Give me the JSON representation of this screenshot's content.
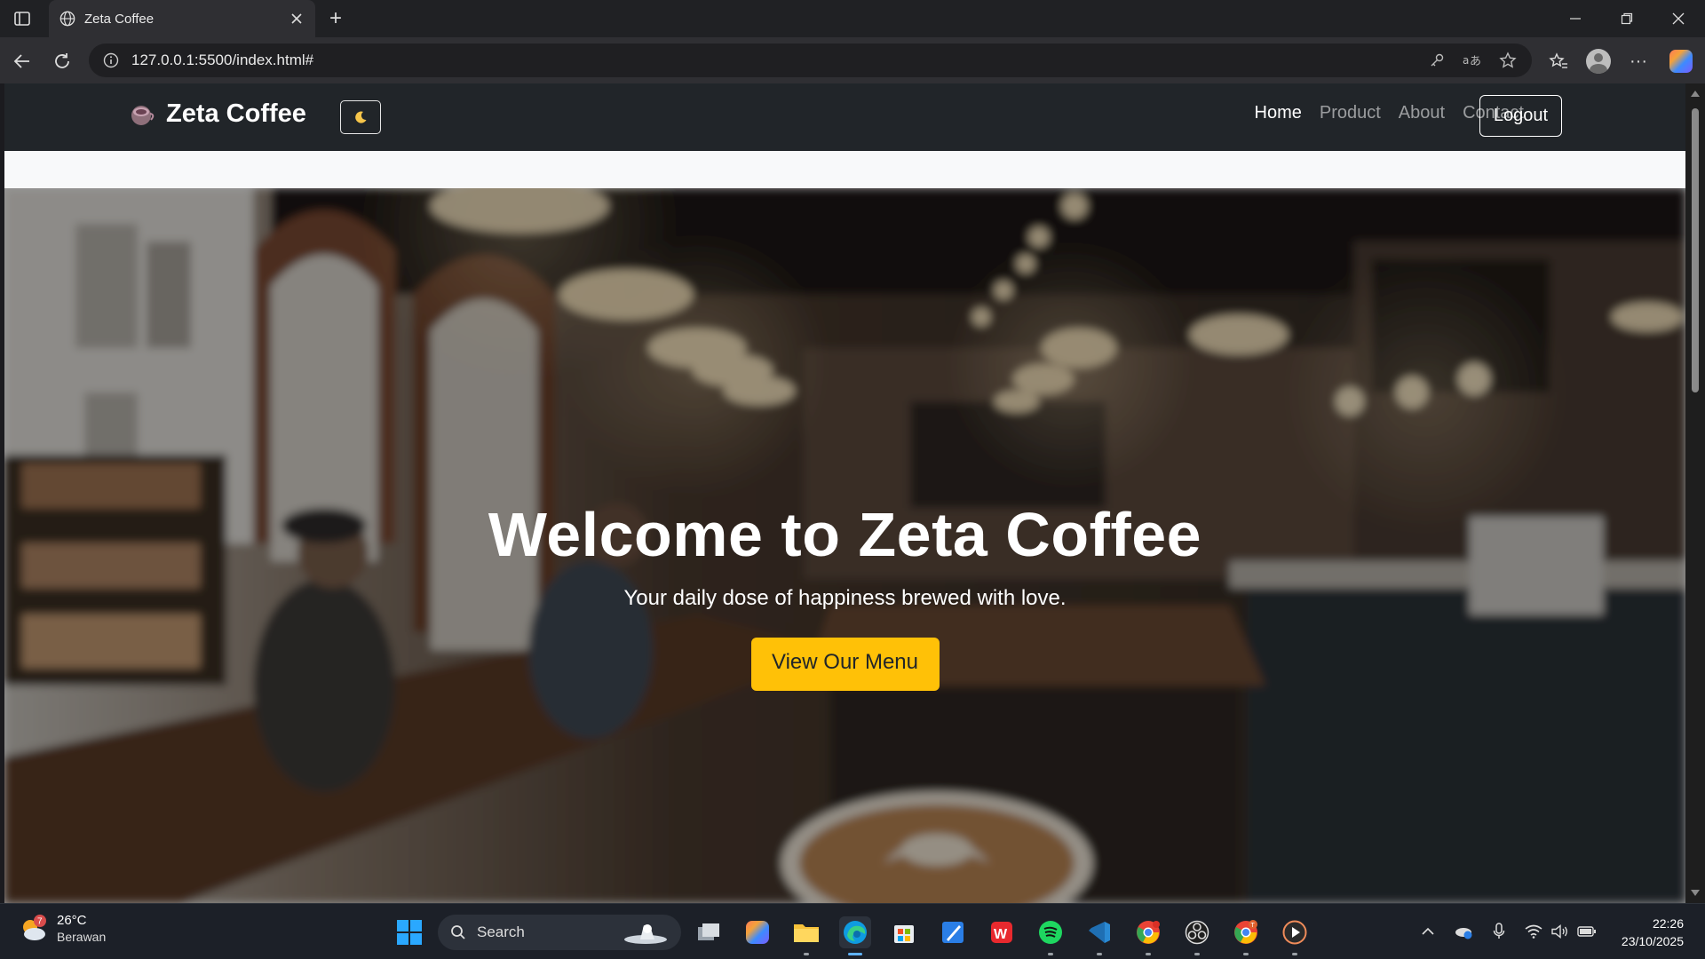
{
  "browser": {
    "tab_title": "Zeta Coffee",
    "url": "127.0.0.1:5500/index.html#"
  },
  "site": {
    "brand": "Zeta Coffee",
    "theme_toggle_icon": "moon-icon",
    "nav": [
      {
        "label": "Home",
        "active": true
      },
      {
        "label": "Product",
        "active": false
      },
      {
        "label": "About",
        "active": false
      },
      {
        "label": "Contact",
        "active": false
      }
    ],
    "logout_label": "Logout"
  },
  "hero": {
    "title": "Welcome to Zeta Coffee",
    "subtitle": "Your daily dose of happiness brewed with love.",
    "button_label": "View Our Menu",
    "button_color": "#ffc107"
  },
  "taskbar": {
    "weather_temp": "26°C",
    "weather_condition": "Berawan",
    "weather_badge": "7",
    "search_label": "Search",
    "time": "22:26",
    "date": "23/10/2025"
  },
  "colors": {
    "navbar": "#212529",
    "accent": "#ffc107"
  }
}
